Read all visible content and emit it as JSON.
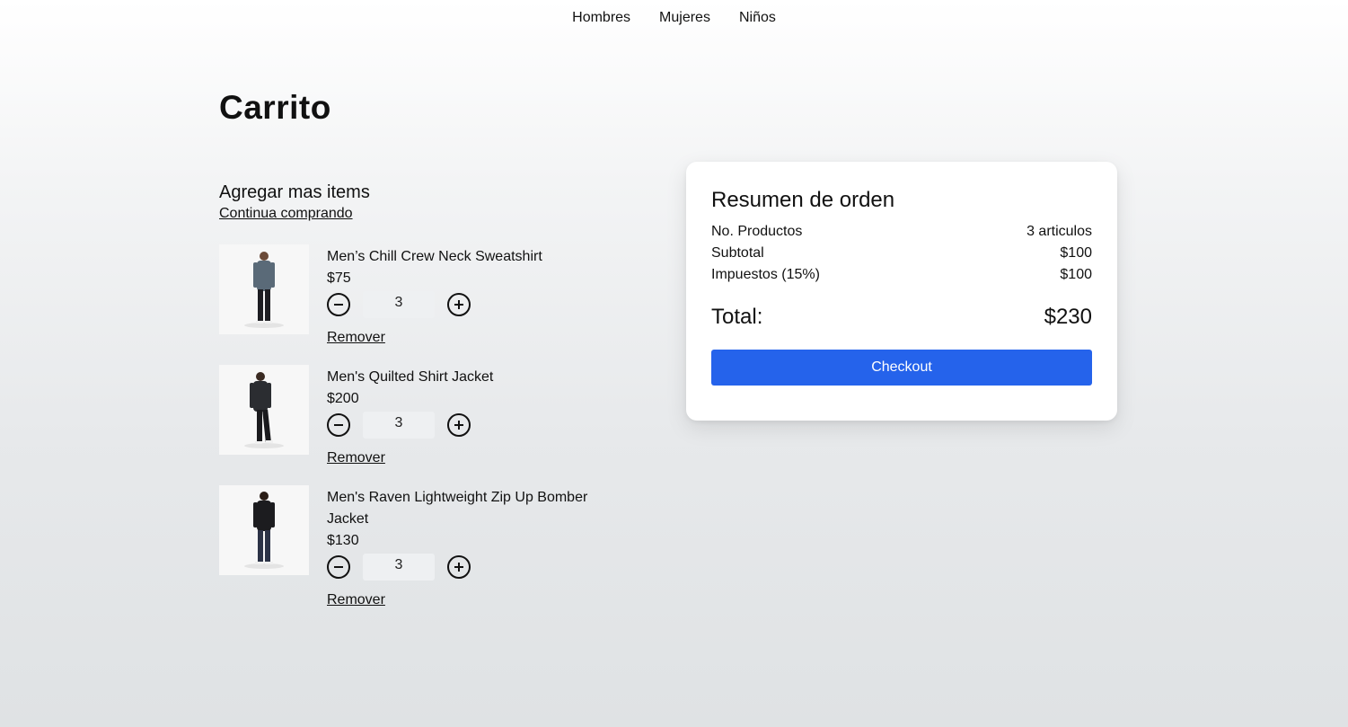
{
  "nav": {
    "items": [
      "Hombres",
      "Mujeres",
      "Niños"
    ]
  },
  "page": {
    "title": "Carrito"
  },
  "cart": {
    "add_more_title": "Agregar mas items",
    "continue_link": "Continua comprando",
    "items": [
      {
        "name": "Men’s Chill Crew Neck Sweatshirt",
        "price": "$75",
        "quantity": "3",
        "remove_label": "Remover",
        "shirt_color": "#5a6a78",
        "pants_color": "#1d1d22"
      },
      {
        "name": "Men's Quilted Shirt Jacket",
        "price": "$200",
        "quantity": "3",
        "remove_label": "Remover",
        "shirt_color": "#2b2d31",
        "pants_color": "#1a1a1d"
      },
      {
        "name": "Men's Raven Lightweight Zip Up Bomber Jacket",
        "price": "$130",
        "quantity": "3",
        "remove_label": "Remover",
        "shirt_color": "#1c1c1f",
        "pants_color": "#2b3246"
      }
    ]
  },
  "summary": {
    "title": "Resumen de orden",
    "rows": [
      {
        "label": "No. Productos",
        "value": "3 articulos"
      },
      {
        "label": "Subtotal",
        "value": "$100"
      },
      {
        "label": "Impuestos (15%)",
        "value": "$100"
      }
    ],
    "total_label": "Total:",
    "total_value": "$230",
    "checkout_label": "Checkout"
  },
  "colors": {
    "accent": "#2563eb",
    "card_bg": "#ffffff",
    "qty_bg": "#eef0f2"
  }
}
